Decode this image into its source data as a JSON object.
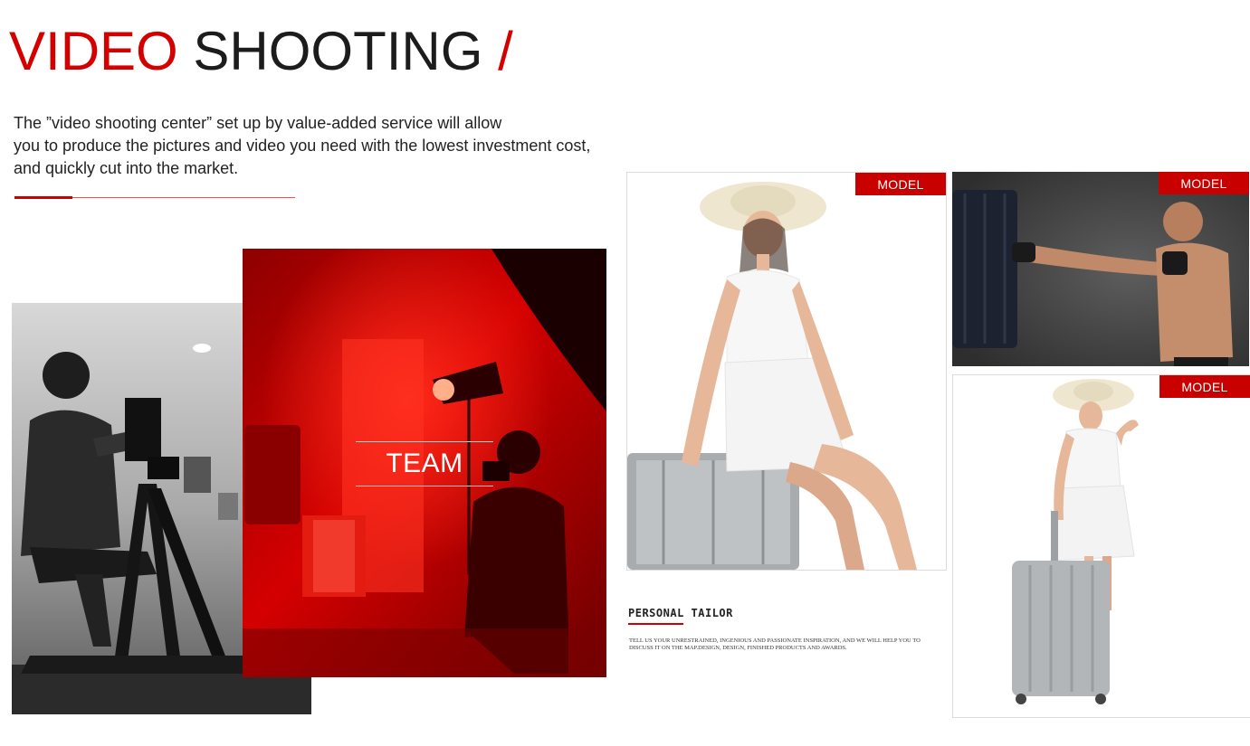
{
  "header": {
    "title_red": "VIDEO",
    "title_dark": "SHOOTING",
    "title_slash": "/",
    "intro_lines": [
      "The ”video shooting center” set up by value-added service will allow",
      "you to produce the pictures and video you need with the lowest investment cost,",
      "and quickly cut into the market."
    ]
  },
  "team": {
    "label": "TEAM"
  },
  "models": {
    "badge_main": "MODEL",
    "badge_boxer": "MODEL",
    "badge_luggage": "MODEL"
  },
  "personal_tailor": {
    "title": "PERSONAL TAILOR",
    "description": "TELL US YOUR UNRESTRAINED, INGENIOUS AND PASSIONATE INSPIRATION, AND WE WILL HELP YOU TO DISCUSS IT ON THE MAP.DESIGN, DESIGN, FINISHED PRODUCTS AND AWARDS."
  },
  "colors": {
    "accent": "#d40000",
    "dark": "#1c1c1c",
    "badge": "#c80000"
  }
}
